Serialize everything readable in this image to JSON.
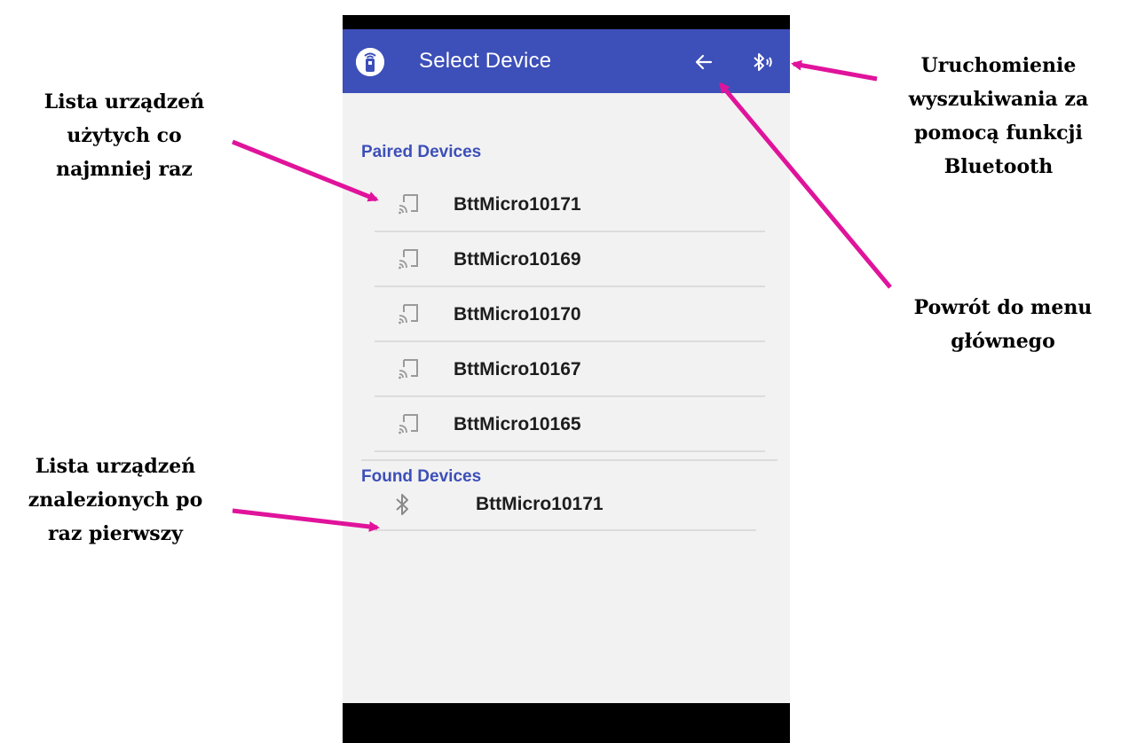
{
  "app": {
    "title": "Select Device",
    "header_color": "#3d4fb8",
    "icons": {
      "app": "remote-control-icon",
      "back": "arrow-left-icon",
      "bluetooth_search": "bluetooth-searching-icon"
    }
  },
  "paired": {
    "title": "Paired Devices",
    "device_icon": "cast-device-icon",
    "devices": [
      "BttMicro10171",
      "BttMicro10169",
      "BttMicro10170",
      "BttMicro10167",
      "BttMicro10165"
    ]
  },
  "found": {
    "title": "Found Devices",
    "device_icon": "bluetooth-icon",
    "devices": [
      "BttMicro10171"
    ]
  },
  "annotations": {
    "accent_color": "#e0139b",
    "paired_list": [
      "Lista urządzeń",
      "użytych co",
      "najmniej raz"
    ],
    "found_list": [
      "Lista urządzeń",
      "znalezionych po",
      "raz pierwszy"
    ],
    "bluetooth_search": [
      "Uruchomienie",
      "wyszukiwania za",
      "pomocą funkcji",
      "Bluetooth"
    ],
    "back": [
      "Powrót do menu",
      "głównego"
    ]
  }
}
